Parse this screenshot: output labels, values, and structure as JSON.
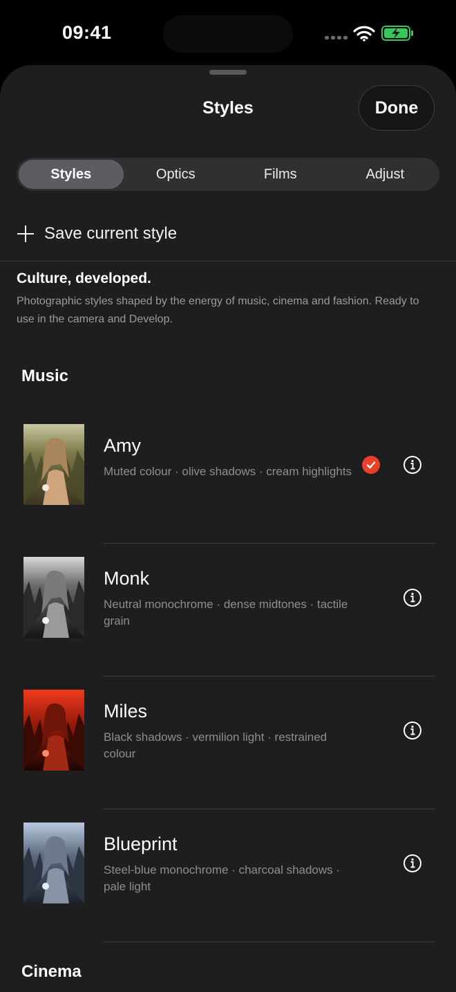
{
  "status_bar": {
    "time": "09:41"
  },
  "sheet": {
    "title": "Styles",
    "done_label": "Done",
    "tabs": [
      {
        "label": "Styles",
        "active": true
      },
      {
        "label": "Optics",
        "active": false
      },
      {
        "label": "Films",
        "active": false
      },
      {
        "label": "Adjust",
        "active": false
      }
    ],
    "save_label": "Save current style",
    "intro": {
      "title": "Culture, developed.",
      "description": "Photographic styles shaped by the energy of music, cinema and fashion. Ready to use in the camera and Develop."
    },
    "sections": [
      {
        "title": "Music",
        "items": [
          {
            "name": "Amy",
            "description": "Muted colour · olive shadows · cream highlights",
            "selected": true,
            "tone": "warm"
          },
          {
            "name": "Monk",
            "description": "Neutral monochrome · dense midtones · tactile grain",
            "selected": false,
            "tone": "mono"
          },
          {
            "name": "Miles",
            "description": "Black shadows · vermilion light · restrained colour",
            "selected": false,
            "tone": "red"
          },
          {
            "name": "Blueprint",
            "description": "Steel-blue monochrome · charcoal shadows · pale light",
            "selected": false,
            "tone": "blue"
          }
        ]
      },
      {
        "title": "Cinema",
        "items": []
      }
    ]
  },
  "colors": {
    "sheet_background": "#1e1e20",
    "selected_check": "#e8402a",
    "battery_charging": "#34c759"
  },
  "icons": {
    "add": "plus-icon",
    "selected": "checkmark-circle-icon",
    "info": "info-circle-icon",
    "wifi": "wifi-icon",
    "battery": "battery-charging-icon"
  }
}
